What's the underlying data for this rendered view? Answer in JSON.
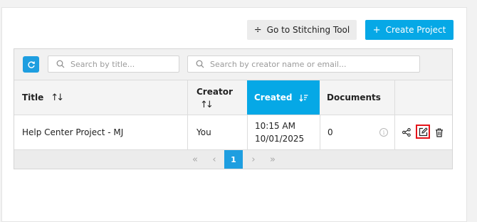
{
  "toolbar": {
    "stitching_label": "Go to Stitching Tool",
    "create_label": "Create Project"
  },
  "search": {
    "title_placeholder": "Search by title...",
    "creator_placeholder": "Search by creator name or email..."
  },
  "columns": {
    "title": "Title",
    "creator": "Creator",
    "created": "Created",
    "documents": "Documents"
  },
  "rows": [
    {
      "title": "Help Center Project - MJ",
      "creator": "You",
      "created_time": "10:15 AM",
      "created_date": "10/01/2025",
      "documents": "0"
    }
  ],
  "pagination": {
    "current_page": "1"
  },
  "colors": {
    "accent": "#06a8e6",
    "highlight": "#e5141a"
  },
  "icons": [
    "stitch-icon",
    "plus-icon",
    "refresh-icon",
    "search-icon",
    "sort-icon",
    "sort-desc-icon",
    "info-icon",
    "share-icon",
    "edit-icon",
    "delete-icon"
  ]
}
